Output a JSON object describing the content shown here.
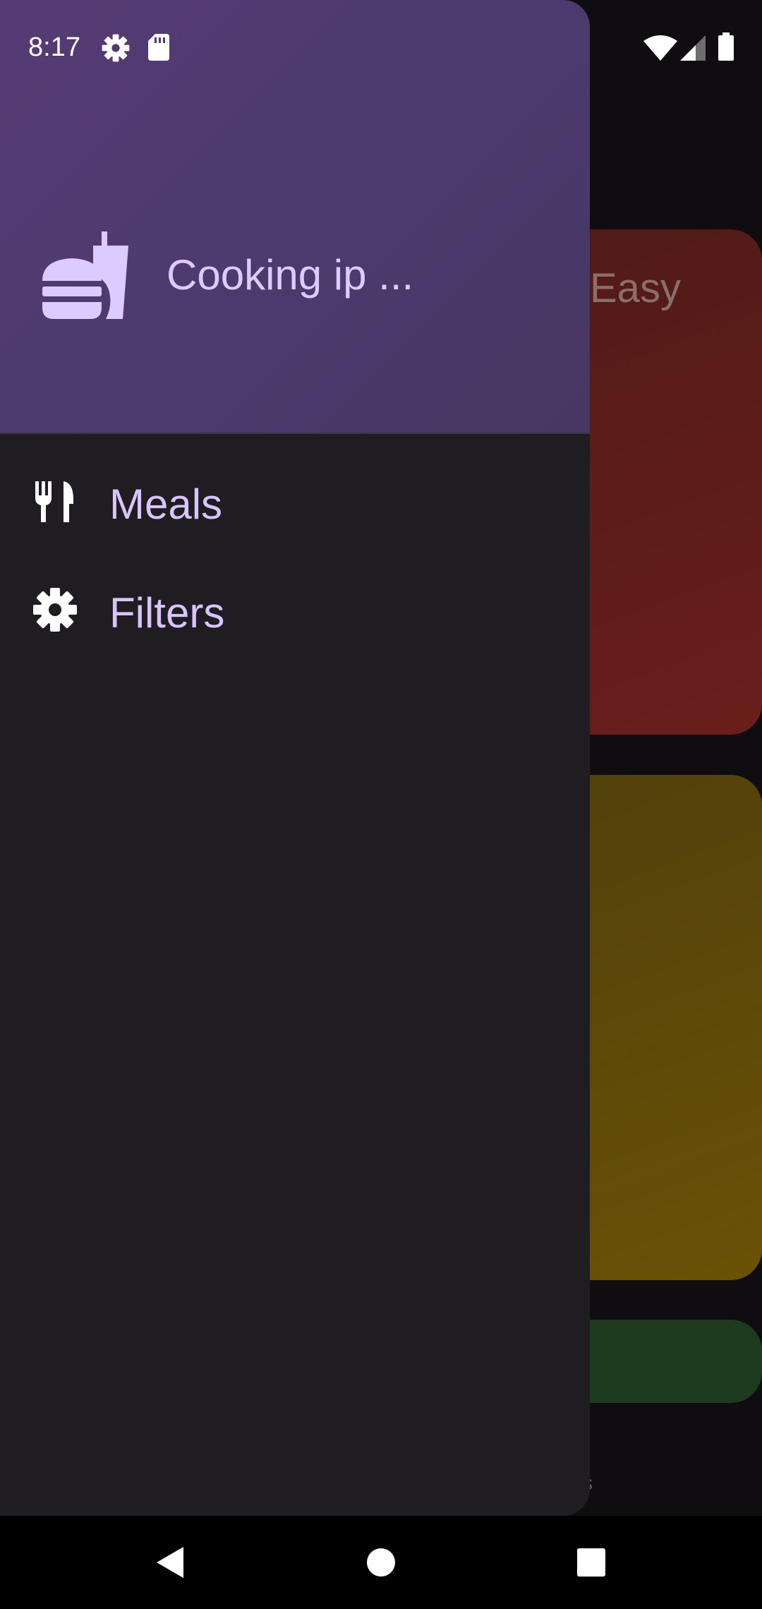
{
  "status_bar": {
    "time": "8:17",
    "icons": [
      "settings-icon",
      "sd-card-icon",
      "wifi-icon",
      "signal-icon",
      "battery-icon"
    ]
  },
  "drawer": {
    "header": {
      "app_icon": "burger-drink-icon",
      "title": "Cooking ip ..."
    },
    "items": [
      {
        "label": "Meals",
        "icon": "restaurant-icon"
      },
      {
        "label": "Filters",
        "icon": "settings-icon"
      }
    ]
  },
  "background": {
    "card_title": "Easy",
    "bottom_tab_text": "tes"
  },
  "system_nav": {
    "buttons": [
      "back-icon",
      "home-icon",
      "recents-icon"
    ]
  },
  "colors": {
    "drawer_bg": "#1f1d21",
    "header_bg": "#4b3a6c",
    "accent_text": "#d8c4ff",
    "card_red": "#5a1c19",
    "card_yellow": "#5e4a08",
    "card_green": "#1d3a1f"
  }
}
